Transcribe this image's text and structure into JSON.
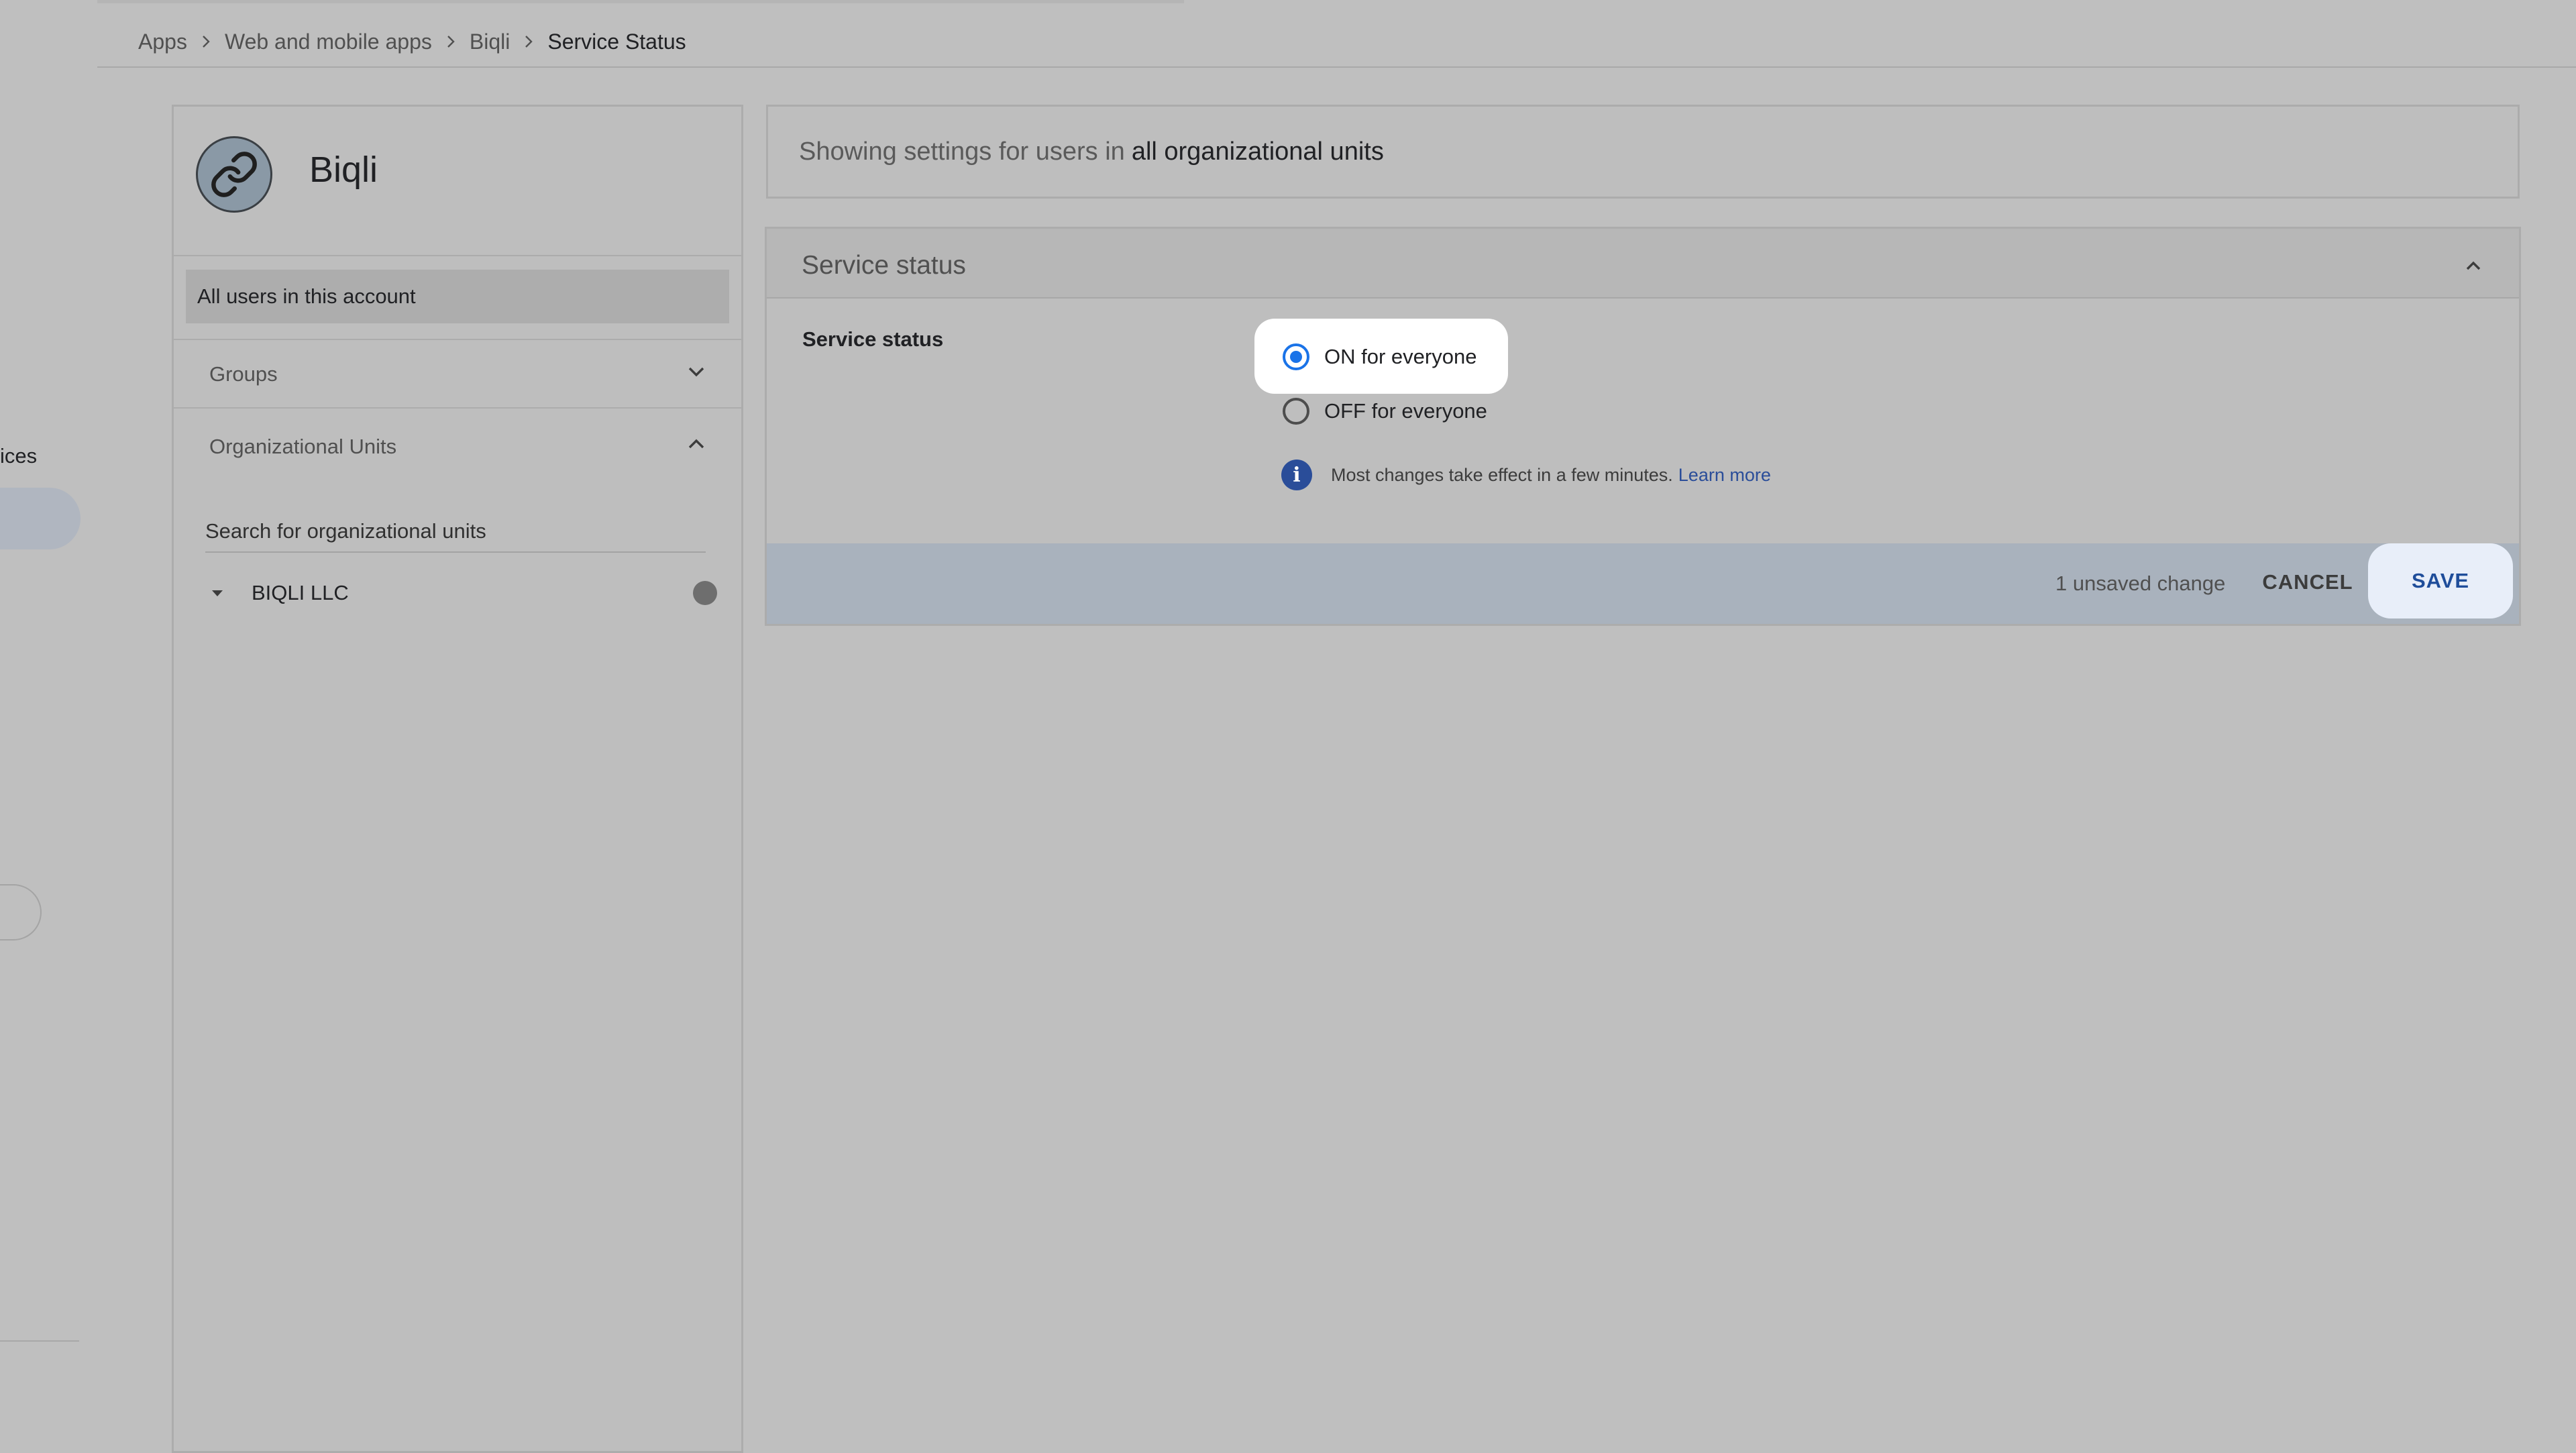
{
  "breadcrumb": {
    "items": [
      "Apps",
      "Web and mobile apps",
      "Biqli"
    ],
    "current": "Service Status"
  },
  "left_nav_fragment": {
    "partial_label": "ices"
  },
  "app": {
    "name": "Biqli",
    "logo_icon": "link-icon"
  },
  "panel": {
    "all_users": "All users in this account",
    "groups_label": "Groups",
    "ou_label": "Organizational Units",
    "ou_search_placeholder": "Search for organizational units",
    "org_name": "BIQLI LLC"
  },
  "scope": {
    "prefix": "Showing settings for users in",
    "target": "all organizational units"
  },
  "card": {
    "title": "Service status",
    "setting_label": "Service status",
    "options": [
      {
        "label": "ON for everyone",
        "selected": true
      },
      {
        "label": "OFF for everyone",
        "selected": false
      }
    ],
    "info_text": "Most changes take effect in a few minutes.",
    "learn_more": "Learn more"
  },
  "actions": {
    "unsaved": "1 unsaved change",
    "cancel": "CANCEL",
    "save": "SAVE"
  },
  "colors": {
    "accent": "#1a73e8",
    "link": "#2a4d99",
    "action_bar": "#a9b2bd",
    "overlay_bg": "#bfbfbf"
  }
}
